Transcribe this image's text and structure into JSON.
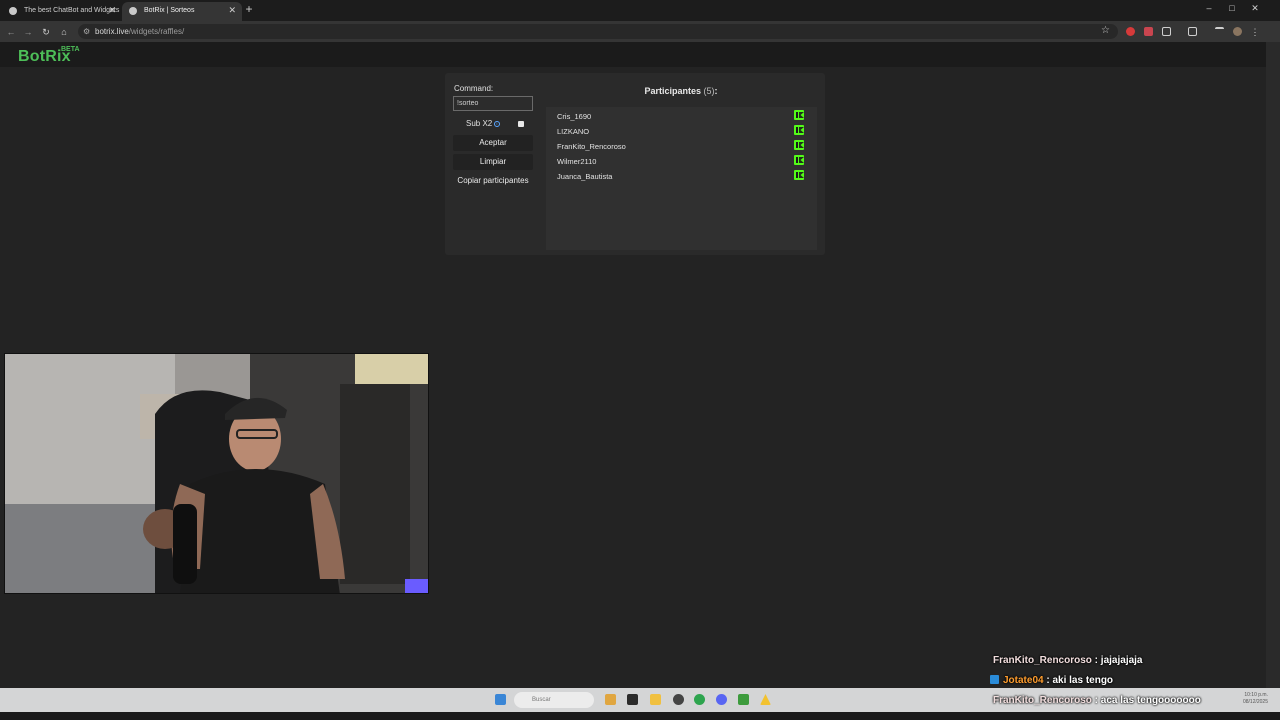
{
  "browser": {
    "tabs": [
      {
        "label": "The best ChatBot and Widgets",
        "active": false
      },
      {
        "label": "BotRix | Sorteos",
        "active": true
      }
    ],
    "url": {
      "host": "botrix.live",
      "path": "/widgets/raffles/"
    },
    "window_controls": [
      "–",
      "□",
      "✕"
    ]
  },
  "app": {
    "logo": "BotRix",
    "badge": "BETA"
  },
  "raffle": {
    "command_label": "Command:",
    "command_value": "!sorteo",
    "sub_label": "Sub X2",
    "sub_checked": true,
    "accept_label": "Aceptar",
    "clear_label": "Limpiar",
    "copy_label": "Copiar participantes",
    "participants_title": "Participantes",
    "participants_count": "(5)",
    "participants_colon": ":",
    "participants": [
      {
        "name": "Cris_1690",
        "platform_icon": "kick-icon"
      },
      {
        "name": "LIZKANO",
        "platform_icon": "kick-icon"
      },
      {
        "name": "FranKito_Rencoroso",
        "platform_icon": "kick-icon"
      },
      {
        "name": "Wilmer2110",
        "platform_icon": "kick-icon"
      },
      {
        "name": "Juanca_Bautista",
        "platform_icon": "kick-icon"
      }
    ]
  },
  "chat": [
    {
      "user": "FranKito_Rencoroso",
      "sep": " : ",
      "message": "jajajajaja"
    },
    {
      "user": "Jotate04",
      "sep": " : ",
      "message": "aki las tengo"
    },
    {
      "user": "FranKito_Rencoroso",
      "sep": " : ",
      "message": "aca las tengooooooo"
    }
  ],
  "taskbar": {
    "search_placeholder": "Buscar",
    "time": "10:10 p.m.",
    "date": "08/12/2025"
  },
  "colors": {
    "brand": "#4dbe58",
    "kick": "#53fc18",
    "background": "#232323"
  }
}
